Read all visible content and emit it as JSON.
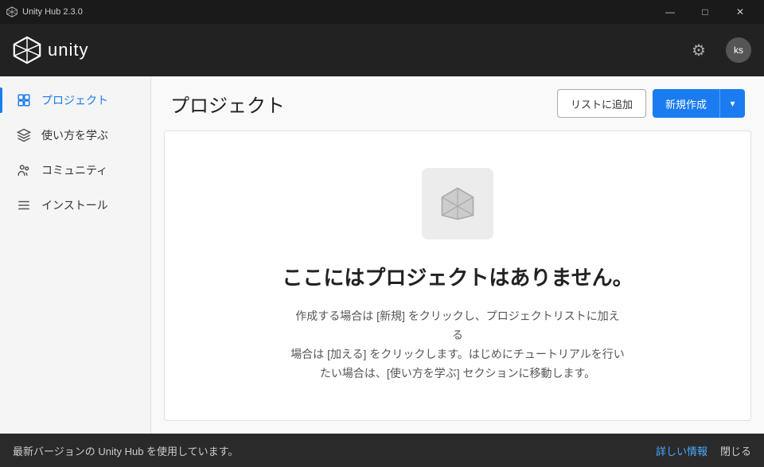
{
  "titlebar": {
    "title": "Unity Hub 2.3.0",
    "icon": "unity-icon",
    "controls": {
      "minimize": "—",
      "maximize": "□",
      "close": "✕"
    }
  },
  "header": {
    "logo_text": "unity",
    "gear_icon": "⚙",
    "user_initials": "ks"
  },
  "sidebar": {
    "items": [
      {
        "id": "projects",
        "label": "プロジェクト",
        "icon": "projects-icon",
        "active": true
      },
      {
        "id": "learn",
        "label": "使い方を学ぶ",
        "icon": "learn-icon",
        "active": false
      },
      {
        "id": "community",
        "label": "コミュニティ",
        "icon": "community-icon",
        "active": false
      },
      {
        "id": "installs",
        "label": "インストール",
        "icon": "install-icon",
        "active": false
      }
    ]
  },
  "content": {
    "page_title": "プロジェクト",
    "add_to_list_label": "リストに追加",
    "new_project_label": "新規作成",
    "dropdown_arrow": "▾",
    "empty_state": {
      "title": "ここにはプロジェクトはありません。",
      "description": "作成する場合は [新規] をクリックし、プロジェクトリストに加える\n場合は [加える] をクリックします。はじめにチュートリアルを行い\nたい場合は、[使い方を学ぶ] セクションに移動します。"
    }
  },
  "notification": {
    "text": "最新バージョンの Unity Hub を使用しています。",
    "detail_label": "詳しい情報",
    "close_label": "閉じる"
  },
  "colors": {
    "accent_blue": "#1a7cf0",
    "titlebar_bg": "#1a1a1a",
    "header_bg": "#222222",
    "sidebar_bg": "#f5f5f5",
    "notification_bg": "#2a2a2a"
  }
}
